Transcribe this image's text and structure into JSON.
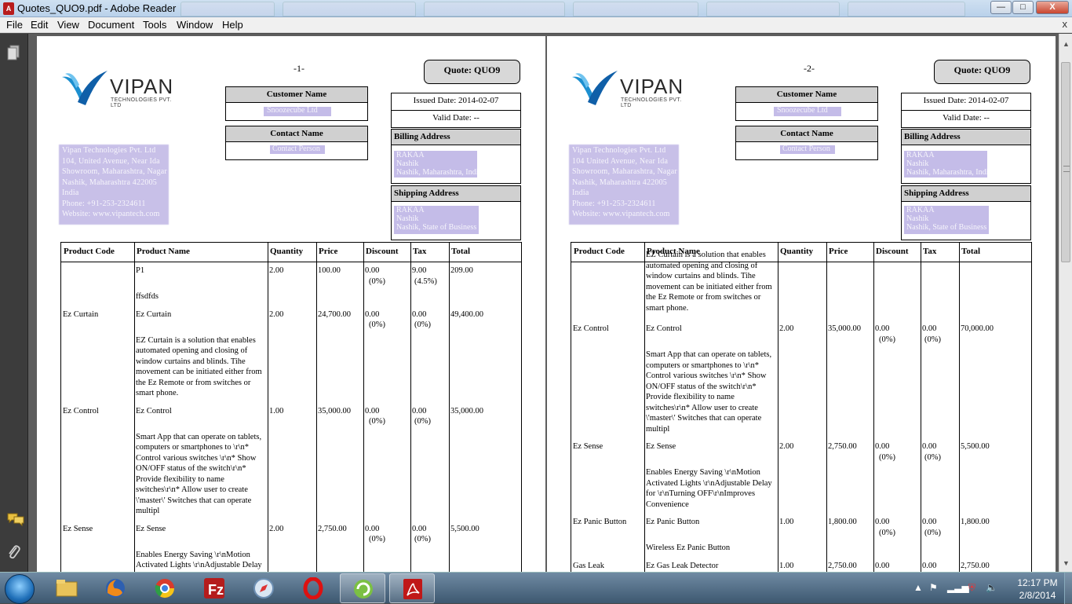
{
  "window": {
    "title": "Quotes_QUO9.pdf - Adobe Reader",
    "app_icon": "pdf-icon"
  },
  "menu": [
    "File",
    "Edit",
    "View",
    "Document",
    "Tools",
    "Window",
    "Help"
  ],
  "window_controls": {
    "minimize": "—",
    "maximize": "□",
    "close": "X",
    "doc_close": "x"
  },
  "left_panel": [
    "pages-icon",
    "comments-icon",
    "attachments-icon"
  ],
  "pages": [
    {
      "page_number": "-1-",
      "logo": {
        "word": "VIPAN",
        "sub": "TECHNOLOGIES PVT. LTD"
      },
      "company_address": [
        "Vipan Technologies Pvt. Ltd",
        "104, United Avenue, Near Ida",
        "Showroom, Maharashtra, Nagar",
        "Nashik, Maharashtra 422005",
        "India",
        "Phone: +91-253-2324611",
        "Website: www.vipantech.com"
      ],
      "customer_name_label": "Customer Name",
      "customer_name_value": "Snoozecube Ltd",
      "contact_name_label": "Contact Name",
      "contact_name_value": "Contact Person",
      "quote_label": "Quote: QUO9",
      "issued_date": "Issued Date: 2014-02-07",
      "valid_date": "Valid Date: --",
      "billing_label": "Billing Address",
      "billing_lines": [
        "RAKAA",
        "Nashik",
        "Nashik, Maharashtra, India"
      ],
      "shipping_label": "Shipping Address",
      "shipping_lines": [
        "RAKAA",
        "Nashik",
        "Nashik, State of Business"
      ],
      "headers": [
        "Product Code",
        "Product Name",
        "Quantity",
        "Price",
        "Discount",
        "Tax",
        "Total"
      ],
      "rows": [
        {
          "code": "",
          "name": "P1",
          "qty": "2.00",
          "price": "100.00",
          "disc": "0.00",
          "disc_pct": "(0%)",
          "tax": "9.00",
          "tax_pct": "(4.5%)",
          "total": "209.00",
          "desc": "ffsdfds"
        },
        {
          "code": "Ez Curtain",
          "name": "Ez Curtain",
          "qty": "2.00",
          "price": "24,700.00",
          "disc": "0.00",
          "disc_pct": "(0%)",
          "tax": "0.00",
          "tax_pct": "(0%)",
          "total": "49,400.00",
          "desc": "EZ Curtain is a solution that enables automated opening and closing of window curtains and blinds. Tihe movement can be initiated either from the  Ez Remote or from switches or smart phone."
        },
        {
          "code": "Ez Control",
          "name": "Ez Control",
          "qty": "1.00",
          "price": "35,000.00",
          "disc": "0.00",
          "disc_pct": "(0%)",
          "tax": "0.00",
          "tax_pct": "(0%)",
          "total": "35,000.00",
          "desc": "Smart App that can operate on tablets, computers or smartphones to \\r\\n* Control  various switches \\r\\n* Show ON/OFF status of the switch\\r\\n* Provide flexibility to name switches\\r\\n* Allow user to create \\'master\\' Switches that can operate multipl"
        },
        {
          "code": "Ez Sense",
          "name": "Ez Sense",
          "qty": "2.00",
          "price": "2,750.00",
          "disc": "0.00",
          "disc_pct": "(0%)",
          "tax": "0.00",
          "tax_pct": "(0%)",
          "total": "5,500.00",
          "desc": "Enables Energy Saving \\r\\nMotion Activated  Lights \\r\\nAdjustable Delay for \\r\\nTurning"
        }
      ]
    },
    {
      "page_number": "-2-",
      "logo": {
        "word": "VIPAN",
        "sub": "TECHNOLOGIES PVT. LTD"
      },
      "company_address": [
        "Vipan Technologies Pvt. Ltd",
        "104 United Avenue, Near Ida",
        "Showroom, Maharashtra, Nagar",
        "Nashik, Maharashtra 422005",
        "India",
        "Phone: +91-253-2324611",
        "Website: www.vipantech.com"
      ],
      "customer_name_label": "Customer Name",
      "customer_name_value": "Snoozecube Ltd",
      "contact_name_label": "Contact Name",
      "contact_name_value": "Contact Person",
      "quote_label": "Quote: QUO9",
      "issued_date": "Issued Date: 2014-02-07",
      "valid_date": "Valid Date: --",
      "billing_label": "Billing Address",
      "billing_lines": [
        "RAKAA",
        "Nashik",
        "Nashik, Maharashtra, India"
      ],
      "shipping_label": "Shipping Address",
      "shipping_lines": [
        "RAKAA",
        "Nashik",
        "Nashik, State of Business"
      ],
      "headers": [
        "Product Code",
        "Product Name",
        "Quantity",
        "Price",
        "Discount",
        "Tax",
        "Total"
      ],
      "rows": [
        {
          "code": "",
          "name": "",
          "qty": "",
          "price": "",
          "disc": "",
          "disc_pct": "",
          "tax": "",
          "tax_pct": "",
          "total": "",
          "desc": "EZ Curtain is a solution that enables automated opening and closing of window curtains and blinds. Tihe movement can be initiated either from the  Ez Remote or from switches or smart phone."
        },
        {
          "code": "Ez Control",
          "name": "Ez Control",
          "qty": "2.00",
          "price": "35,000.00",
          "disc": "0.00",
          "disc_pct": "(0%)",
          "tax": "0.00",
          "tax_pct": "(0%)",
          "total": "70,000.00",
          "desc": "Smart App that can operate on tablets, computers or smartphones to \\r\\n* Control  various switches \\r\\n* Show ON/OFF status of the switch\\r\\n* Provide flexibility to name switches\\r\\n* Allow user to create \\'master\\' Switches that can operate multipl"
        },
        {
          "code": "Ez Sense",
          "name": "Ez Sense",
          "qty": "2.00",
          "price": "2,750.00",
          "disc": "0.00",
          "disc_pct": "(0%)",
          "tax": "0.00",
          "tax_pct": "(0%)",
          "total": "5,500.00",
          "desc": "Enables Energy Saving \\r\\nMotion Activated  Lights \\r\\nAdjustable Delay for \\r\\nTurning OFF\\r\\nImproves Convenience"
        },
        {
          "code": "Ez Panic Button",
          "name": "Ez Panic Button",
          "qty": "1.00",
          "price": "1,800.00",
          "disc": "0.00",
          "disc_pct": "(0%)",
          "tax": "0.00",
          "tax_pct": "(0%)",
          "total": "1,800.00",
          "desc": "Wireless  Ez Panic Button"
        },
        {
          "code": "Gas Leak",
          "name": "Ez Gas Leak Detector",
          "qty": "1.00",
          "price": "2,750.00",
          "disc": "0.00",
          "disc_pct": "",
          "tax": "0.00",
          "tax_pct": "",
          "total": "2,750.00",
          "desc": ""
        }
      ]
    }
  ],
  "taskbar": {
    "apps": [
      "windows-explorer-icon",
      "firefox-icon",
      "chrome-icon",
      "filezilla-icon",
      "safari-icon",
      "opera-icon",
      "app-icon",
      "adobe-reader-icon"
    ],
    "clock_time": "12:17 PM",
    "clock_date": "2/8/2014"
  }
}
